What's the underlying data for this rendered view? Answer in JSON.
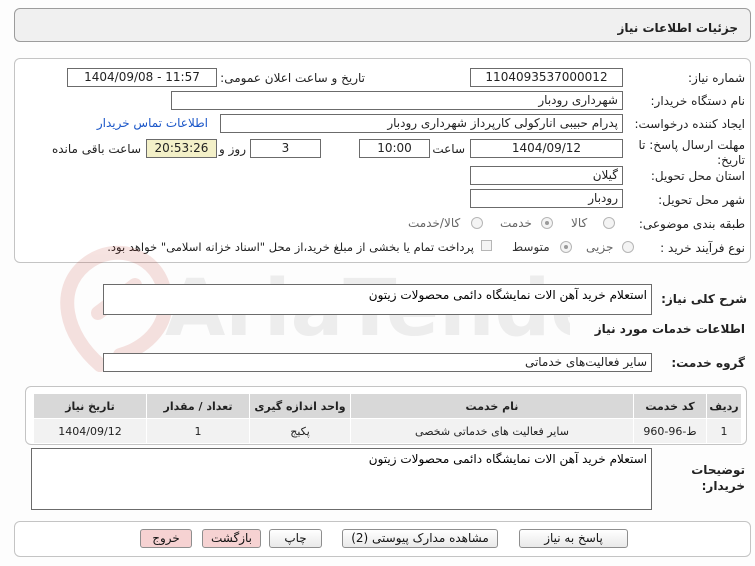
{
  "header": {
    "title": "جزئیات اطلاعات نیاز"
  },
  "form": {
    "need_number": {
      "label": "شماره نیاز:",
      "value": "1104093537000012"
    },
    "announce_datetime": {
      "label": "تاریخ و ساعت اعلان عمومی:",
      "value": "1404/09/08 - 11:57"
    },
    "buyer_org": {
      "label": "نام دستگاه خریدار:",
      "value": "شهرداری رودبار"
    },
    "requester": {
      "label": "ایجاد کننده درخواست:",
      "value": "پدرام حبیبی انارکولی کارپرداز شهرداری رودبار",
      "contact_link": "اطلاعات تماس خریدار"
    },
    "deadline": {
      "label_line1": "مهلت ارسال پاسخ: تا",
      "label_line2": "تاریخ:",
      "date": "1404/09/12",
      "time_label": "ساعت",
      "time": "10:00",
      "days": "3",
      "days_label": "روز و",
      "remaining": "20:53:26",
      "remaining_label": "ساعت باقی مانده"
    },
    "province": {
      "label": "استان محل تحویل:",
      "value": "گیلان"
    },
    "city": {
      "label": "شهر محل تحویل:",
      "value": "رودبار"
    },
    "category": {
      "label": "طبقه بندی موضوعی:",
      "options": [
        "کالا",
        "خدمت",
        "کالا/خدمت"
      ],
      "selected": "خدمت"
    },
    "purchase_type": {
      "label": "نوع فرآیند خرید :",
      "options": [
        "جزیی",
        "متوسط"
      ],
      "selected": "متوسط",
      "payment_note": "پرداخت تمام یا بخشی از مبلغ خرید،از محل \"اسناد خزانه اسلامی\" خواهد بود."
    }
  },
  "summary": {
    "label": "شرح کلی نیاز:",
    "value": "استعلام خرید آهن الات نمایشگاه دائمی محصولات زیتون"
  },
  "services": {
    "section_title": "اطلاعات خدمات مورد نیاز",
    "group_label": "گروه خدمت:",
    "group_value": "سایر فعالیت‌های خدماتی",
    "columns": [
      "ردیف",
      "کد خدمت",
      "نام خدمت",
      "واحد اندازه گیری",
      "تعداد / مقدار",
      "تاریخ نیاز"
    ],
    "rows": [
      {
        "index": "1",
        "code": "ط-96-960",
        "name": "سایر فعالیت های خدماتی شخصی",
        "unit": "پکیج",
        "qty": "1",
        "date": "1404/09/12"
      }
    ]
  },
  "buyer_notes": {
    "label_line1": "توضیحات",
    "label_line2": "خریدار:",
    "value": "استعلام خرید آهن الات نمایشگاه دائمی محصولات زیتون"
  },
  "buttons": {
    "reply": "پاسخ به نیاز",
    "attachments": "مشاهده مدارک پیوستی (2)",
    "print": "چاپ",
    "back": "بازگشت",
    "exit": "خروج"
  },
  "watermark": {
    "text": "AriaTender.net"
  },
  "colors": {
    "link": "#1a56c8",
    "remaining_bg": "#f3f0c8",
    "pink_button": "#f6d2d2",
    "table_header": "#d8d8d8"
  }
}
